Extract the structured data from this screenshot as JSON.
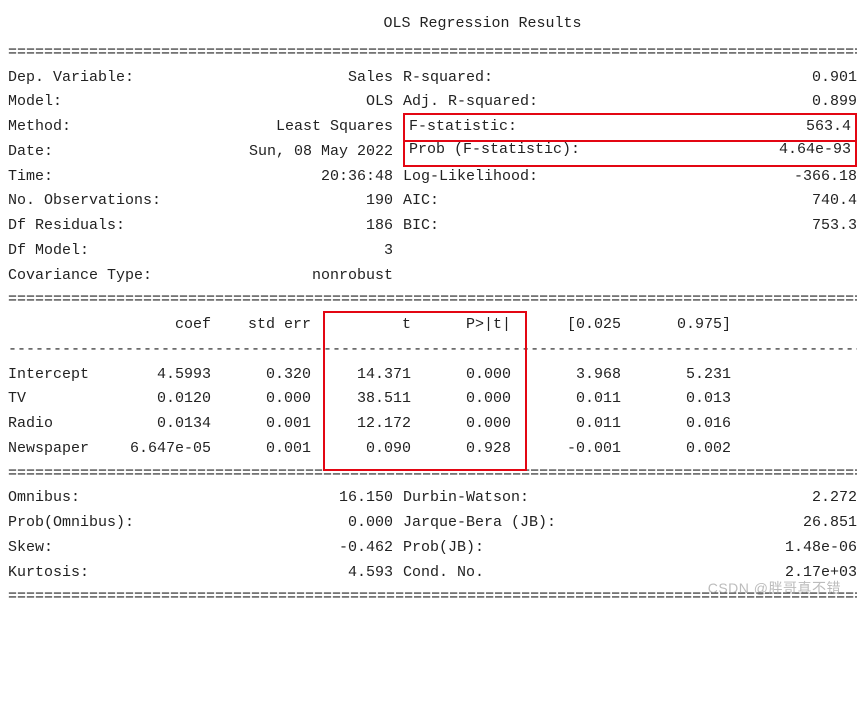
{
  "title": "OLS Regression Results",
  "rules": {
    "eq": "================================================================================================",
    "dash": "------------------------------------------------------------------------------------------------"
  },
  "top": {
    "left_labels": [
      "Dep. Variable:",
      "Model:",
      "Method:",
      "Date:",
      "Time:",
      "No. Observations:",
      "Df Residuals:",
      "Df Model:",
      "Covariance Type:"
    ],
    "left_values": [
      "Sales",
      "OLS",
      "Least Squares",
      "Sun, 08 May 2022",
      "20:36:48",
      "190",
      "186",
      "3",
      "nonrobust"
    ],
    "right_labels": [
      "R-squared:",
      "Adj. R-squared:",
      "F-statistic:",
      "Prob (F-statistic):",
      "Log-Likelihood:",
      "AIC:",
      "BIC:"
    ],
    "right_values": [
      "0.901",
      "0.899",
      "563.4",
      "4.64e-93",
      "-366.18",
      "740.4",
      "753.3"
    ]
  },
  "coef": {
    "headers": [
      "",
      "coef",
      "std err",
      "t",
      "P>|t|",
      "[0.025",
      "0.975]"
    ],
    "rows": [
      {
        "name": "Intercept",
        "coef": "4.5993",
        "se": "0.320",
        "t": "14.371",
        "p": "0.000",
        "lo": "3.968",
        "hi": "5.231"
      },
      {
        "name": "TV",
        "coef": "0.0120",
        "se": "0.000",
        "t": "38.511",
        "p": "0.000",
        "lo": "0.011",
        "hi": "0.013"
      },
      {
        "name": "Radio",
        "coef": "0.0134",
        "se": "0.001",
        "t": "12.172",
        "p": "0.000",
        "lo": "0.011",
        "hi": "0.016"
      },
      {
        "name": "Newspaper",
        "coef": "6.647e-05",
        "se": "0.001",
        "t": "0.090",
        "p": "0.928",
        "lo": "-0.001",
        "hi": "0.002"
      }
    ]
  },
  "diag": {
    "left_labels": [
      "Omnibus:",
      "Prob(Omnibus):",
      "Skew:",
      "Kurtosis:"
    ],
    "left_values": [
      "16.150",
      "0.000",
      "-0.462",
      "4.593"
    ],
    "right_labels": [
      "Durbin-Watson:",
      "Jarque-Bera (JB):",
      "Prob(JB):",
      "Cond. No."
    ],
    "right_values": [
      "2.272",
      "26.851",
      "1.48e-06",
      "2.17e+03"
    ]
  },
  "watermark": "CSDN @胖哥真不错"
}
